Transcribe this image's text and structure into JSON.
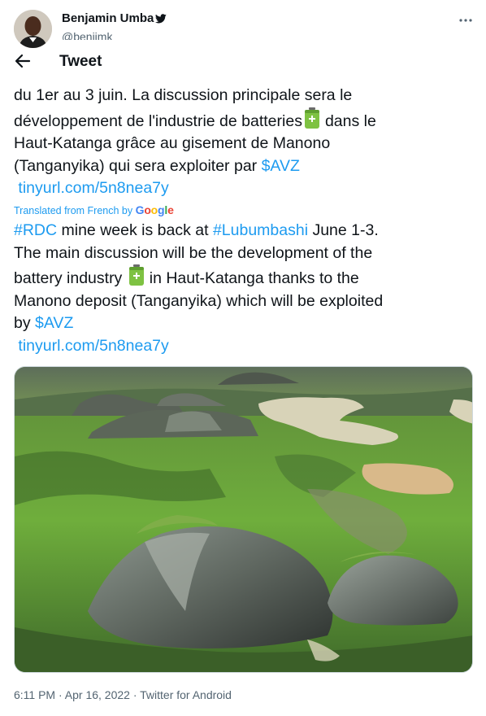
{
  "author": {
    "name": "Benjamin Umba",
    "handle": "@benjimk"
  },
  "header": {
    "title": "Tweet"
  },
  "original": {
    "lines": [
      "du 1er au 3 juin. La discussion principale sera le",
      "développement de l'industrie de batteries",
      "dans le",
      "Haut-Katanga grâce au gisement de Manono",
      "(Tanganyika) qui sera exploiter par",
      "$AVZ"
    ],
    "link": "tinyurl.com/5n8nea7y"
  },
  "translation": {
    "label": "Translated from French by",
    "provider": "Google"
  },
  "translated": {
    "tag_rdc": "#RDC",
    "line1_mid": "mine week is back at",
    "tag_lubumbashi": "#Lubumbashi",
    "line1_end": "June 1-3.",
    "line2": "The main discussion will be the development of the",
    "line3_a": "battery industry",
    "line3_b": "in Haut-Katanga thanks to the",
    "line4": "Manono deposit (Tanganyika) which will be exploited",
    "line5_a": "by",
    "cashtag": "$AVZ",
    "link": "tinyurl.com/5n8nea7y"
  },
  "media": {
    "description_icon": "aerial-mine-photo"
  },
  "footer": {
    "meta": "6:11 PM · Apr 16, 2022 · Twitter for Android"
  },
  "colors": {
    "link": "#1d9bf0",
    "text": "#0f1419",
    "secondary": "#536471"
  }
}
